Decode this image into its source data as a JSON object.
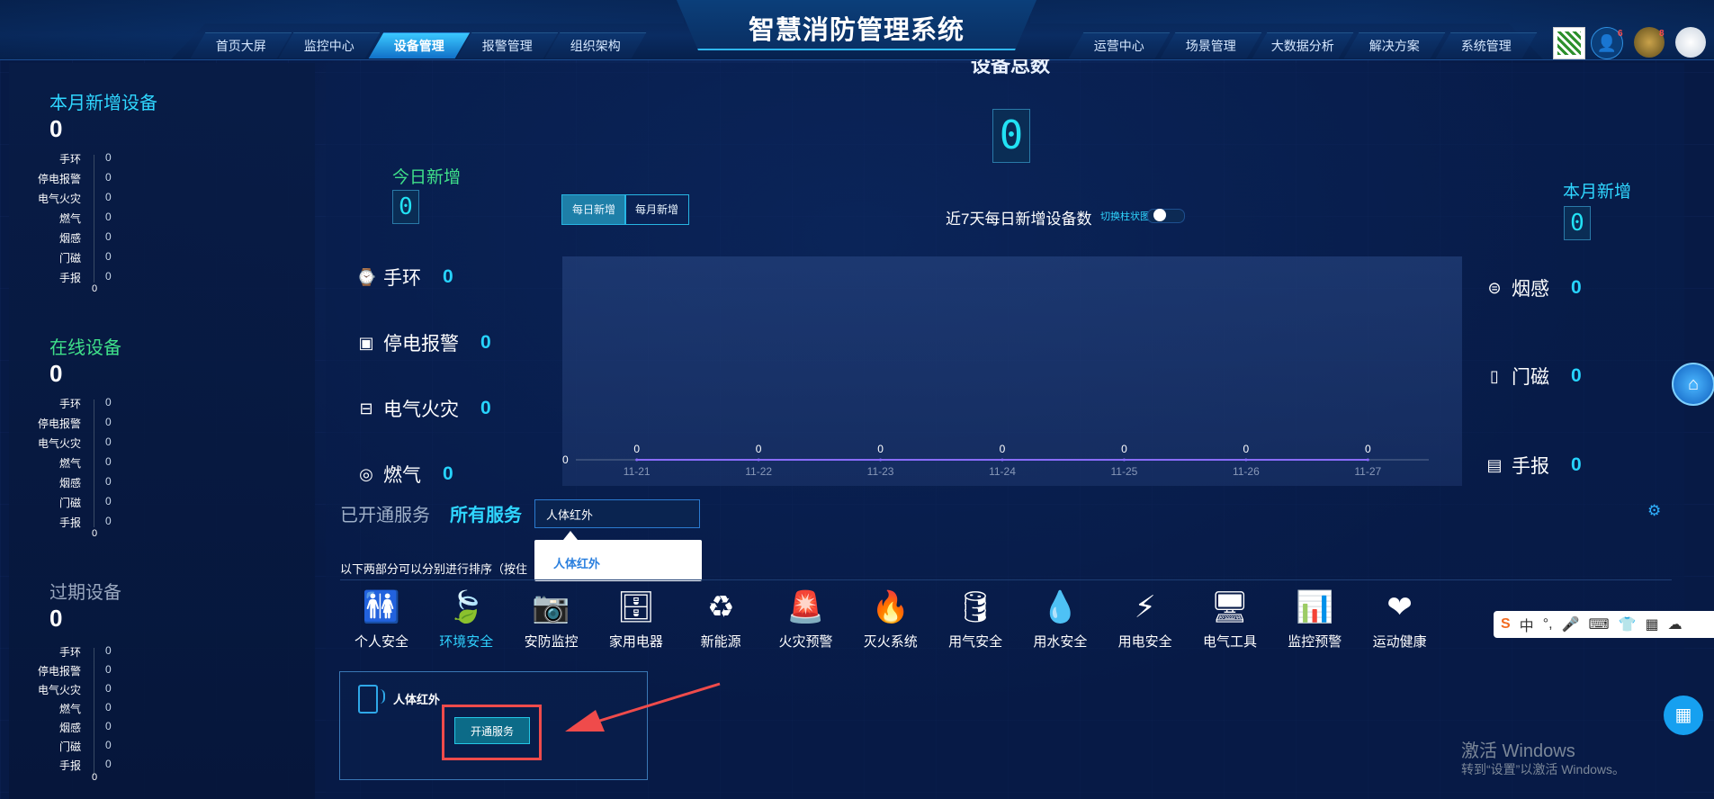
{
  "header": {
    "title": "智慧消防管理系统",
    "nav_left": [
      "首页大屏",
      "监控中心",
      "设备管理",
      "报警管理",
      "组织架构"
    ],
    "nav_right": [
      "运营中心",
      "场景管理",
      "大数据分析",
      "解决方案",
      "系统管理"
    ],
    "active_tab": "设备管理",
    "badges": [
      "6",
      "8"
    ]
  },
  "left_panel": {
    "sections": [
      {
        "title": "本月新增设备",
        "total": "0",
        "title_color": "#2fd6ff",
        "rows": [
          [
            "手环",
            "0"
          ],
          [
            "停电报警",
            "0"
          ],
          [
            "电气火灾",
            "0"
          ],
          [
            "燃气",
            "0"
          ],
          [
            "烟感",
            "0"
          ],
          [
            "门磁",
            "0"
          ],
          [
            "手报",
            "0"
          ]
        ],
        "axis_zero": "0"
      },
      {
        "title": "在线设备",
        "total": "0",
        "title_color": "#3fe08a",
        "rows": [
          [
            "手环",
            "0"
          ],
          [
            "停电报警",
            "0"
          ],
          [
            "电气火灾",
            "0"
          ],
          [
            "燃气",
            "0"
          ],
          [
            "烟感",
            "0"
          ],
          [
            "门磁",
            "0"
          ],
          [
            "手报",
            "0"
          ]
        ],
        "axis_zero": "0"
      },
      {
        "title": "过期设备",
        "total": "0",
        "title_color": "#9aa8bf",
        "rows": [
          [
            "手环",
            "0"
          ],
          [
            "停电报警",
            "0"
          ],
          [
            "电气火灾",
            "0"
          ],
          [
            "燃气",
            "0"
          ],
          [
            "烟感",
            "0"
          ],
          [
            "门磁",
            "0"
          ],
          [
            "手报",
            "0"
          ]
        ],
        "axis_zero": "0"
      }
    ]
  },
  "main": {
    "total_title": "设备总数",
    "total_value": "0",
    "today_new_title": "今日新增",
    "today_new_value": "0",
    "month_new_title": "本月新增",
    "month_new_value": "0",
    "toggle_daily": "每日新增",
    "toggle_monthly": "每月新增",
    "chart_title": "近7天每日新增设备数",
    "chart_switch_label": "切换柱状图",
    "left_categories": [
      {
        "icon": "bracelet-icon",
        "glyph": "⌚",
        "label": "手环",
        "value": "0"
      },
      {
        "icon": "power-alarm-icon",
        "glyph": "▣",
        "label": "停电报警",
        "value": "0"
      },
      {
        "icon": "electric-fire-icon",
        "glyph": "⊟",
        "label": "电气火灾",
        "value": "0"
      },
      {
        "icon": "gas-icon",
        "glyph": "◎",
        "label": "燃气",
        "value": "0"
      }
    ],
    "right_categories": [
      {
        "icon": "smoke-detector-icon",
        "glyph": "⊜",
        "label": "烟感",
        "value": "0"
      },
      {
        "icon": "door-sensor-icon",
        "glyph": "▯",
        "label": "门磁",
        "value": "0"
      },
      {
        "icon": "manual-alarm-icon",
        "glyph": "▤",
        "label": "手报",
        "value": "0"
      }
    ]
  },
  "chart_data": {
    "type": "line",
    "x": [
      "11-21",
      "11-22",
      "11-23",
      "11-24",
      "11-25",
      "11-26",
      "11-27"
    ],
    "values": [
      0,
      0,
      0,
      0,
      0,
      0,
      0
    ],
    "title": "近7天每日新增设备数",
    "y_tick": "0",
    "line_color": "#8a6cff"
  },
  "services": {
    "tab_opened": "已开通服务",
    "tab_all": "所有服务",
    "search_value": "人体红外",
    "dropdown_option": "人体红外",
    "hint": "以下两部分可以分别进行排序（按住",
    "categories": [
      {
        "label": "个人安全",
        "icon": "personal-safety-icon",
        "glyph": "🚻"
      },
      {
        "label": "环境安全",
        "icon": "environment-safety-icon",
        "glyph": "🍃"
      },
      {
        "label": "安防监控",
        "icon": "security-camera-icon",
        "glyph": "📷"
      },
      {
        "label": "家用电器",
        "icon": "home-appliance-icon",
        "glyph": "🗄"
      },
      {
        "label": "新能源",
        "icon": "recycle-icon",
        "glyph": "♻"
      },
      {
        "label": "火灾预警",
        "icon": "fire-alarm-icon",
        "glyph": "🚨"
      },
      {
        "label": "灭火系统",
        "icon": "fire-extinguish-icon",
        "glyph": "🔥"
      },
      {
        "label": "用气安全",
        "icon": "gas-safety-icon",
        "glyph": "🛢"
      },
      {
        "label": "用水安全",
        "icon": "water-safety-icon",
        "glyph": "💧"
      },
      {
        "label": "用电安全",
        "icon": "electricity-safety-icon",
        "glyph": "⚡"
      },
      {
        "label": "电气工具",
        "icon": "electric-tool-icon",
        "glyph": "🖥"
      },
      {
        "label": "监控预警",
        "icon": "monitor-alert-icon",
        "glyph": "📊"
      },
      {
        "label": "运动健康",
        "icon": "health-heart-icon",
        "glyph": "❤"
      }
    ],
    "active_category": "环境安全",
    "card_title": "人体红外",
    "card_button": "开通服务"
  },
  "overlay": {
    "windows_line1": "激活 Windows",
    "windows_line2": "转到“设置”以激活 Windows。",
    "ime_items": [
      "S",
      "中",
      "°,",
      "🎤",
      "⌨",
      "👕",
      "▦",
      "☁"
    ]
  },
  "colors": {
    "accent": "#27d4ff",
    "highlight": "#ef4b4b"
  }
}
